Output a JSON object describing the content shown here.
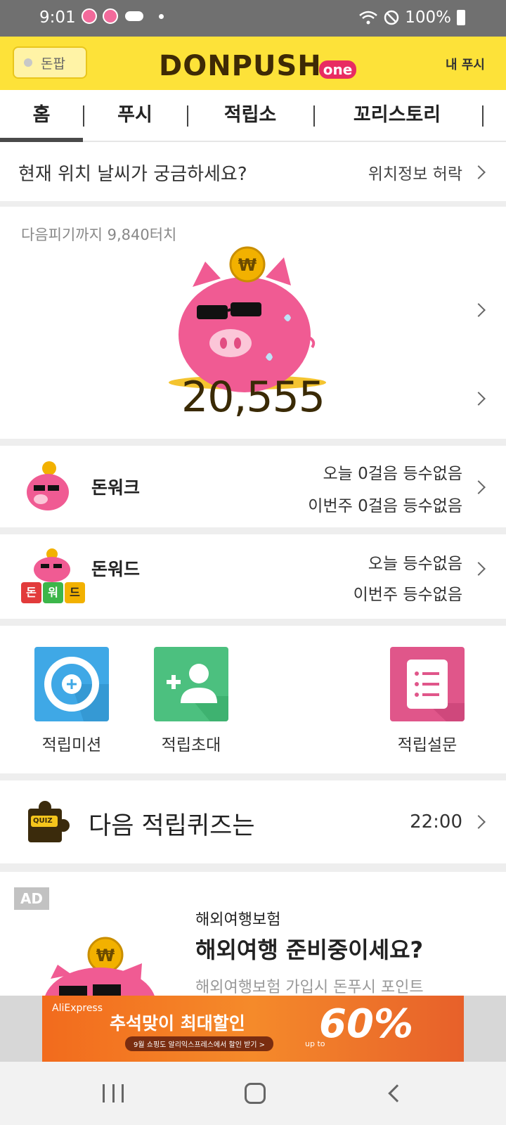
{
  "status": {
    "time": "9:01",
    "battery": "100%"
  },
  "header": {
    "donpop_label": "돈팝",
    "logo_main": "DONPUSH",
    "logo_badge": "one",
    "mypush": "내 푸시"
  },
  "tabs": [
    "홈",
    "푸시",
    "적립소",
    "꼬리스토리"
  ],
  "location": {
    "question": "현재 위치 날씨가 궁금하세요?",
    "permit": "위치정보 허락"
  },
  "piggy": {
    "touch_text": "다음피기까지 9,840터치",
    "points": "20,555",
    "coin_symbol": "₩"
  },
  "donwalk": {
    "title": "돈워크",
    "today": "오늘 0걸음 등수없음",
    "week": "이번주 0걸음 등수없음"
  },
  "donword": {
    "title": "돈워드",
    "today": "오늘 등수없음",
    "week": "이번주 등수없음",
    "tiles": [
      "돈",
      "워",
      "드"
    ]
  },
  "grid": [
    {
      "label": "적립미션",
      "icon": "plus-circle-icon",
      "color": "#3fa8e6"
    },
    {
      "label": "적립초대",
      "icon": "add-person-icon",
      "color": "#4cc07f"
    },
    {
      "label": "적립설문",
      "icon": "list-icon",
      "color": "#e0568a"
    }
  ],
  "quiz": {
    "title": "다음 적립퀴즈는",
    "time": "22:00",
    "badge": "QUIZ"
  },
  "ad": {
    "badge": "AD",
    "category": "해외여행보험",
    "headline": "해외여행 준비중이세요?",
    "desc": "해외여행보험 가입시 돈푸시 포인트"
  },
  "banner": {
    "brand": "AliExpress",
    "promo": "추석맞이 최대할인",
    "sub": "9월 쇼핑도 알리익스프레스에서 할인 받기 >",
    "upto": "up to",
    "percent": "60%"
  }
}
